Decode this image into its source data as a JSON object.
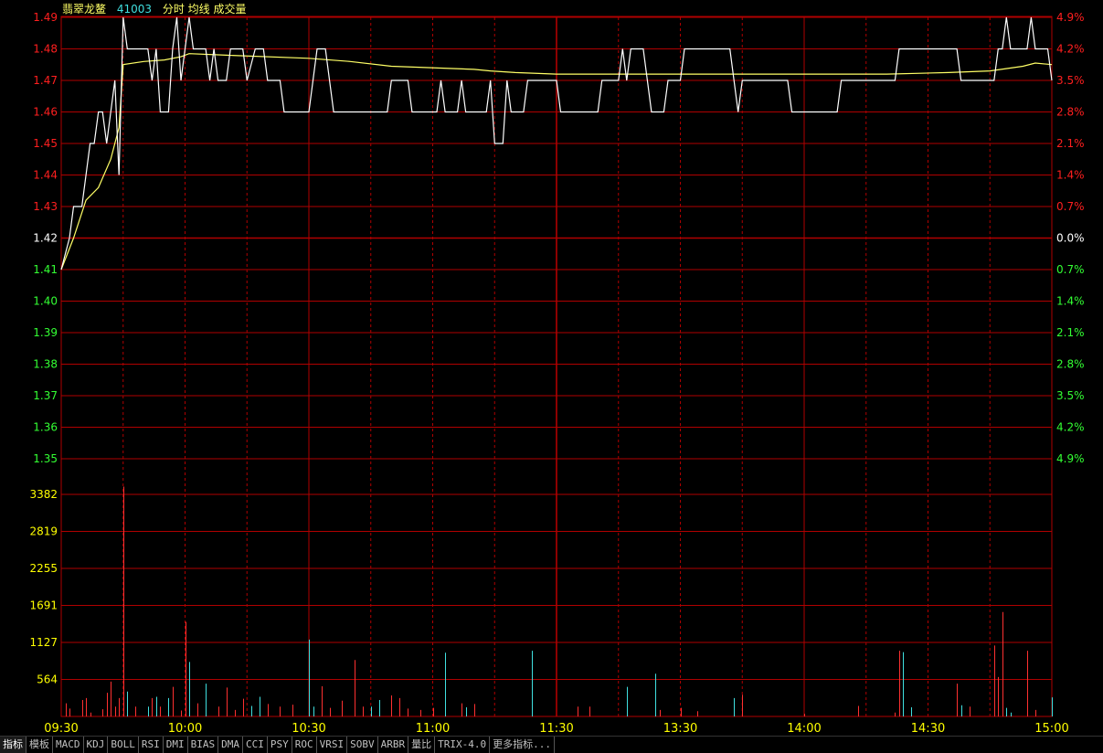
{
  "header": {
    "stock_name": "翡翠龙鳌",
    "stock_code": "41003",
    "indicators_label": "分时 均线 成交量"
  },
  "tabs": [
    "指标",
    "模板",
    "MACD",
    "KDJ",
    "BOLL",
    "RSI",
    "DMI",
    "BIAS",
    "DMA",
    "CCI",
    "PSY",
    "ROC",
    "VRSI",
    "SOBV",
    "ARBR",
    "量比",
    "TRIX-4.0",
    "更多指标..."
  ],
  "colors": {
    "background": "#000000",
    "grid": "#b00000",
    "up": "#ff1f1f",
    "down": "#33ff33",
    "neutral": "#ffffff",
    "price_line": "#ffffff",
    "avg_line": "#ffff66",
    "volume_axis": "#ffff00",
    "volume_up": "#ff3030",
    "volume_down": "#40e0e0"
  },
  "chart_data": [
    {
      "type": "line",
      "title": "",
      "ylim": [
        1.35,
        1.49
      ],
      "prev_close": 1.42,
      "x_ticks": [
        "09:30",
        "10:00",
        "10:30",
        "11:00",
        "11:30",
        "13:30",
        "14:00",
        "14:30",
        "15:00"
      ],
      "y_ticks_left": [
        "1.49",
        "1.48",
        "1.47",
        "1.46",
        "1.45",
        "1.44",
        "1.43",
        "1.42",
        "1.41",
        "1.40",
        "1.39",
        "1.38",
        "1.37",
        "1.36",
        "1.35"
      ],
      "y_ticks_right": [
        "4.9%",
        "4.2%",
        "3.5%",
        "2.8%",
        "2.1%",
        "1.4%",
        "0.7%",
        "0.0%",
        "0.7%",
        "1.4%",
        "2.1%",
        "2.8%",
        "3.5%",
        "4.2%",
        "4.9%"
      ],
      "series": [
        {
          "points": [
            [
              0,
              1.41
            ],
            [
              2,
              1.42
            ],
            [
              3,
              1.43
            ],
            [
              5,
              1.43
            ],
            [
              7,
              1.45
            ],
            [
              8,
              1.45
            ],
            [
              9,
              1.46
            ],
            [
              10,
              1.46
            ],
            [
              11,
              1.45
            ],
            [
              13,
              1.47
            ],
            [
              14,
              1.44
            ],
            [
              15,
              1.49
            ],
            [
              16,
              1.48
            ],
            [
              21,
              1.48
            ],
            [
              22,
              1.47
            ],
            [
              23,
              1.48
            ],
            [
              24,
              1.46
            ],
            [
              26,
              1.46
            ],
            [
              27,
              1.48
            ],
            [
              28,
              1.49
            ],
            [
              29,
              1.47
            ],
            [
              30,
              1.48
            ],
            [
              31,
              1.49
            ],
            [
              32,
              1.48
            ],
            [
              35,
              1.48
            ],
            [
              36,
              1.47
            ],
            [
              37,
              1.48
            ],
            [
              38,
              1.47
            ],
            [
              40,
              1.47
            ],
            [
              41,
              1.48
            ],
            [
              44,
              1.48
            ],
            [
              45,
              1.47
            ],
            [
              47,
              1.48
            ],
            [
              49,
              1.48
            ],
            [
              50,
              1.47
            ],
            [
              53,
              1.47
            ],
            [
              54,
              1.46
            ],
            [
              60,
              1.46
            ],
            [
              61,
              1.47
            ],
            [
              62,
              1.48
            ],
            [
              64,
              1.48
            ],
            [
              65,
              1.47
            ],
            [
              66,
              1.46
            ],
            [
              79,
              1.46
            ],
            [
              80,
              1.47
            ],
            [
              84,
              1.47
            ],
            [
              85,
              1.46
            ],
            [
              91,
              1.46
            ],
            [
              92,
              1.47
            ],
            [
              93,
              1.46
            ],
            [
              96,
              1.46
            ],
            [
              97,
              1.47
            ],
            [
              98,
              1.46
            ],
            [
              103,
              1.46
            ],
            [
              104,
              1.47
            ],
            [
              105,
              1.45
            ],
            [
              107,
              1.45
            ],
            [
              108,
              1.47
            ],
            [
              109,
              1.46
            ],
            [
              111,
              1.46
            ],
            [
              112,
              1.46
            ],
            [
              113,
              1.47
            ],
            [
              120,
              1.47
            ],
            [
              121,
              1.46
            ],
            [
              130,
              1.46
            ],
            [
              131,
              1.47
            ],
            [
              135,
              1.47
            ],
            [
              136,
              1.48
            ],
            [
              137,
              1.47
            ],
            [
              138,
              1.48
            ],
            [
              141,
              1.48
            ],
            [
              142,
              1.47
            ],
            [
              143,
              1.46
            ],
            [
              146,
              1.46
            ],
            [
              147,
              1.47
            ],
            [
              150,
              1.47
            ],
            [
              151,
              1.48
            ],
            [
              162,
              1.48
            ],
            [
              163,
              1.47
            ],
            [
              164,
              1.46
            ],
            [
              165,
              1.47
            ],
            [
              176,
              1.47
            ],
            [
              177,
              1.46
            ],
            [
              188,
              1.46
            ],
            [
              189,
              1.47
            ],
            [
              202,
              1.47
            ],
            [
              203,
              1.48
            ],
            [
              204,
              1.48
            ],
            [
              205,
              1.48
            ],
            [
              217,
              1.48
            ],
            [
              218,
              1.47
            ],
            [
              225,
              1.47
            ],
            [
              226,
              1.47
            ],
            [
              227,
              1.48
            ],
            [
              228,
              1.48
            ],
            [
              229,
              1.49
            ],
            [
              230,
              1.48
            ],
            [
              234,
              1.48
            ],
            [
              235,
              1.49
            ],
            [
              236,
              1.48
            ],
            [
              239,
              1.48
            ],
            [
              240,
              1.47
            ]
          ]
        },
        {
          "points": [
            [
              0,
              1.41
            ],
            [
              3,
              1.42
            ],
            [
              6,
              1.432
            ],
            [
              9,
              1.436
            ],
            [
              12,
              1.445
            ],
            [
              14,
              1.455
            ],
            [
              15,
              1.475
            ],
            [
              20,
              1.476
            ],
            [
              25,
              1.4765
            ],
            [
              29,
              1.4775
            ],
            [
              31,
              1.4785
            ],
            [
              40,
              1.478
            ],
            [
              60,
              1.477
            ],
            [
              70,
              1.476
            ],
            [
              80,
              1.4745
            ],
            [
              100,
              1.4735
            ],
            [
              104,
              1.473
            ],
            [
              110,
              1.4725
            ],
            [
              120,
              1.472
            ],
            [
              140,
              1.472
            ],
            [
              160,
              1.472
            ],
            [
              180,
              1.472
            ],
            [
              200,
              1.472
            ],
            [
              215,
              1.4725
            ],
            [
              225,
              1.473
            ],
            [
              233,
              1.4745
            ],
            [
              236,
              1.4755
            ],
            [
              240,
              1.475
            ]
          ]
        }
      ]
    },
    {
      "type": "bar",
      "title": "",
      "ylim": [
        0,
        3382
      ],
      "y_ticks": [
        "3382",
        "2819",
        "2255",
        "1691",
        "1127",
        "564"
      ],
      "bars": [
        [
          1,
          200,
          "u"
        ],
        [
          2,
          120,
          "u"
        ],
        [
          5,
          250,
          "u"
        ],
        [
          6,
          280,
          "u"
        ],
        [
          7,
          60,
          "u"
        ],
        [
          10,
          110,
          "u"
        ],
        [
          11,
          360,
          "u"
        ],
        [
          12,
          530,
          "u"
        ],
        [
          13,
          150,
          "u"
        ],
        [
          14,
          280,
          "u"
        ],
        [
          15,
          3500,
          "u"
        ],
        [
          16,
          380,
          "d"
        ],
        [
          18,
          150,
          "u"
        ],
        [
          21,
          150,
          "d"
        ],
        [
          22,
          280,
          "u"
        ],
        [
          23,
          300,
          "d"
        ],
        [
          24,
          150,
          "u"
        ],
        [
          26,
          280,
          "d"
        ],
        [
          27,
          450,
          "u"
        ],
        [
          29,
          90,
          "u"
        ],
        [
          30,
          1440,
          "u"
        ],
        [
          31,
          830,
          "d"
        ],
        [
          33,
          200,
          "u"
        ],
        [
          35,
          500,
          "d"
        ],
        [
          38,
          150,
          "u"
        ],
        [
          40,
          440,
          "u"
        ],
        [
          42,
          100,
          "u"
        ],
        [
          44,
          270,
          "u"
        ],
        [
          46,
          160,
          "d"
        ],
        [
          48,
          300,
          "d"
        ],
        [
          50,
          190,
          "u"
        ],
        [
          53,
          150,
          "u"
        ],
        [
          56,
          180,
          "u"
        ],
        [
          60,
          1170,
          "d"
        ],
        [
          61,
          150,
          "d"
        ],
        [
          63,
          460,
          "u"
        ],
        [
          65,
          130,
          "u"
        ],
        [
          68,
          240,
          "u"
        ],
        [
          71,
          860,
          "u"
        ],
        [
          73,
          150,
          "u"
        ],
        [
          75,
          150,
          "d"
        ],
        [
          77,
          250,
          "d"
        ],
        [
          80,
          320,
          "u"
        ],
        [
          82,
          280,
          "u"
        ],
        [
          84,
          120,
          "u"
        ],
        [
          87,
          100,
          "u"
        ],
        [
          90,
          130,
          "u"
        ],
        [
          93,
          970,
          "d"
        ],
        [
          97,
          200,
          "u"
        ],
        [
          98,
          140,
          "d"
        ],
        [
          100,
          190,
          "u"
        ],
        [
          114,
          1000,
          "d"
        ],
        [
          125,
          150,
          "u"
        ],
        [
          128,
          150,
          "u"
        ],
        [
          137,
          450,
          "d"
        ],
        [
          144,
          80,
          "u"
        ],
        [
          145,
          100,
          "u"
        ],
        [
          144,
          650,
          "d"
        ],
        [
          150,
          130,
          "u"
        ],
        [
          154,
          80,
          "u"
        ],
        [
          163,
          280,
          "d"
        ],
        [
          165,
          330,
          "u"
        ],
        [
          180,
          40,
          "u"
        ],
        [
          193,
          160,
          "u"
        ],
        [
          202,
          60,
          "u"
        ],
        [
          203,
          1000,
          "u"
        ],
        [
          204,
          980,
          "d"
        ],
        [
          206,
          140,
          "d"
        ],
        [
          217,
          500,
          "u"
        ],
        [
          218,
          170,
          "d"
        ],
        [
          220,
          150,
          "u"
        ],
        [
          226,
          1080,
          "u"
        ],
        [
          227,
          600,
          "u"
        ],
        [
          228,
          1590,
          "u"
        ],
        [
          229,
          130,
          "d"
        ],
        [
          230,
          60,
          "d"
        ],
        [
          234,
          1000,
          "u"
        ],
        [
          236,
          100,
          "u"
        ],
        [
          240,
          290,
          "d"
        ]
      ]
    }
  ]
}
